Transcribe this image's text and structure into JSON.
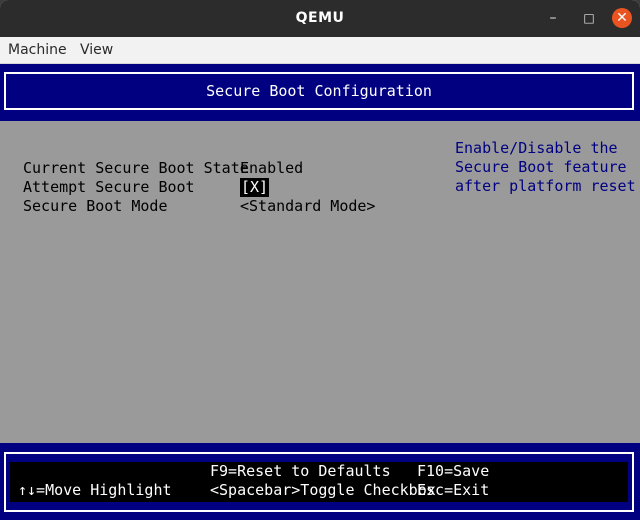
{
  "window": {
    "title": "QEMU",
    "minimize_glyph": "–",
    "maximize_glyph": "□",
    "close_glyph": "✕"
  },
  "menubar": {
    "items": [
      "Machine",
      "View"
    ]
  },
  "bios": {
    "header_title": "Secure Boot Configuration",
    "rows": [
      {
        "label": "Current Secure Boot State",
        "value": "Enabled"
      },
      {
        "label": "Attempt Secure Boot",
        "value": "[X]"
      },
      {
        "label": "Secure Boot Mode",
        "value": "<Standard Mode>"
      }
    ],
    "help_lines": [
      "Enable/Disable the",
      "Secure Boot feature",
      "after platform reset"
    ],
    "footer": {
      "reset_defaults": "F9=Reset to Defaults",
      "save": "F10=Save",
      "move_highlight": "↑↓=Move Highlight",
      "toggle_checkbox": "<Spacebar>Toggle Checkbox",
      "exit": "Esc=Exit"
    },
    "colors": {
      "background_blue": "#000080",
      "content_gray": "#9a9a9a",
      "help_text": "#000080"
    }
  }
}
